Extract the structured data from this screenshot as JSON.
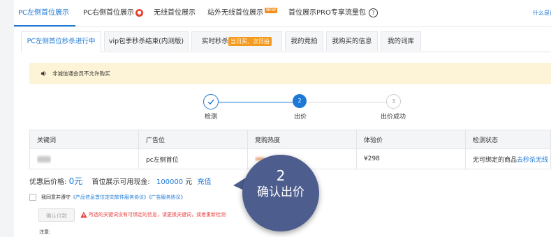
{
  "top_tabs": [
    {
      "label": "PC左侧首位展示"
    },
    {
      "label": "PC右侧首位展示"
    },
    {
      "label": "无线首位展示"
    },
    {
      "label": "站外无线首位展示",
      "badge": "NEW"
    },
    {
      "label": "首位展示PRO专享流量包"
    }
  ],
  "top_right_link": "什么是首",
  "sub_tabs": [
    {
      "label": "PC左侧首位秒杀进行中"
    },
    {
      "label": "vip包季秒杀结束(内测版)"
    },
    {
      "label": "实时秒杀",
      "badge": "当日买、次日投"
    },
    {
      "label": "我的竞拍"
    },
    {
      "label": "我购买的信息"
    },
    {
      "label": "我的词库"
    }
  ],
  "notice_text": "非诚信通会员不允许购买",
  "steps": [
    {
      "number": "1",
      "label": "检测",
      "status": "done"
    },
    {
      "number": "2",
      "label": "出价",
      "status": "current"
    },
    {
      "number": "3",
      "label": "出价成功",
      "status": "pending"
    }
  ],
  "table": {
    "headers": [
      "关键词",
      "广告位",
      "竞购热度",
      "体验价",
      "检测状态"
    ],
    "row": {
      "ad_slot": "pc左侧首位",
      "price": "¥298",
      "status_text": "无可绑定的商品",
      "status_link": "去秒杀无线"
    }
  },
  "pricing": {
    "discount_label": "优惠后价格:",
    "discount_value": "0元",
    "cash_label": "首位展示可用现金:",
    "cash_value": "100000",
    "cash_unit": "元",
    "recharge": "充值"
  },
  "agreement": {
    "prefix": "我同意并遵守",
    "link1": "《产品信息首位定向软件服务协议》",
    "link2": "《广告服务协议》"
  },
  "confirm_button": "确认付款",
  "warning": "所选的关键词没有可绑定的信息，请更换关键词，或者重新检测",
  "note_label": "注意:",
  "callout": {
    "number": "2",
    "label": "确认出价"
  },
  "colors": {
    "accent": "#1d78d6",
    "badge_orange": "#f49a1e",
    "warning_red": "#e64340",
    "callout_bg": "#4d5d8e",
    "notice_bg": "#fdf3d6"
  },
  "icons": {
    "hot": "fire-icon",
    "help": "question-circle-icon",
    "speaker": "speaker-icon",
    "check": "check-icon",
    "warn": "warning-triangle-icon"
  }
}
